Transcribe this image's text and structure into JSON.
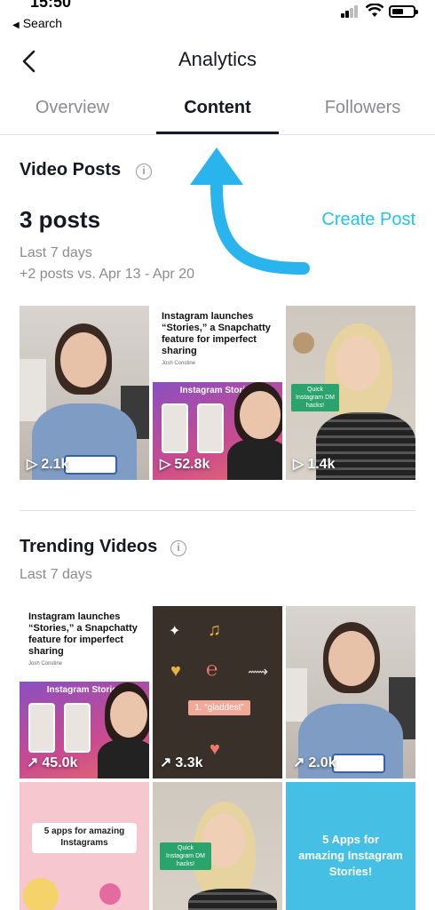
{
  "status_bar": {
    "time": "15:50",
    "back_label": "Search"
  },
  "nav": {
    "title": "Analytics"
  },
  "tabs": [
    {
      "label": "Overview",
      "active": false
    },
    {
      "label": "Content",
      "active": true
    },
    {
      "label": "Followers",
      "active": false
    }
  ],
  "video_posts": {
    "title": "Video Posts",
    "count": "3 posts",
    "create_label": "Create Post",
    "period": "Last 7 days",
    "comparison": "+2 posts vs. Apr 13 - Apr 20",
    "items": [
      {
        "views": "2.1k",
        "icon": "play-icon"
      },
      {
        "views": "52.8k",
        "icon": "play-icon"
      },
      {
        "views": "1.4k",
        "icon": "play-icon"
      }
    ]
  },
  "trending_videos": {
    "title": "Trending Videos",
    "period": "Last 7 days",
    "items": [
      {
        "views": "45.0k",
        "icon": "trend-arrow-icon"
      },
      {
        "views": "3.3k",
        "icon": "trend-arrow-icon"
      },
      {
        "views": "2.0k",
        "icon": "trend-arrow-icon"
      },
      {
        "views": ""
      },
      {
        "views": ""
      },
      {
        "views": ""
      }
    ]
  },
  "thumb_text": {
    "article_headline": "Instagram launches “Stories,” a Snapchatty feature for imperfect sharing",
    "article_author": "Josh Constine",
    "ig_stories": "Instagram Stories",
    "dm_hacks": "Quick Instagram DM hacks!",
    "gladdest": "1. “gladdest”",
    "apps": "5 apps for amazing Instagrams",
    "apps2": "5 Apps for amazing Instagram Stories!"
  },
  "colors": {
    "accent": "#20c4e8",
    "text": "#161823",
    "muted": "#8a8b91",
    "arrow": "#2ab4ee"
  }
}
